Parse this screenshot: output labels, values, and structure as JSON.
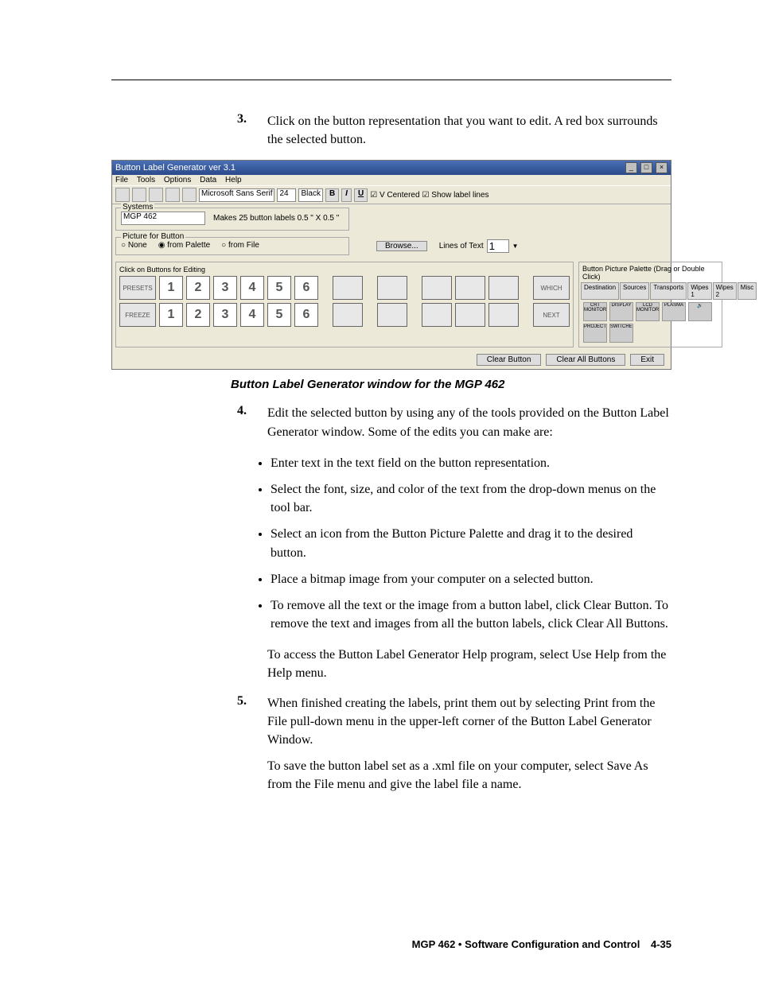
{
  "step3": {
    "num": "3.",
    "text": "Click on the button representation that you want to edit.  A red box surrounds the selected button."
  },
  "app": {
    "title": "Button Label Generator  ver 3.1",
    "minimize": "_",
    "restore": "□",
    "close": "×",
    "menu": {
      "file": "File",
      "tools": "Tools",
      "options": "Options",
      "data": "Data",
      "help": "Help"
    },
    "toolbar": {
      "font": "Microsoft Sans Serif",
      "size": "24",
      "color": "Black",
      "b": "B",
      "i": "I",
      "u": "U",
      "vc": "V Centered",
      "sl": "Show label lines"
    },
    "systems": {
      "label": "Systems",
      "value": "MGP 462",
      "note": "Makes 25 button labels 0.5 \" X 0.5 \""
    },
    "picture": {
      "label": "Picture for Button",
      "none": "None",
      "fromPal": "from Palette",
      "fromFile": "from File",
      "browse": "Browse...",
      "lot": "Lines of Text",
      "lotVal": "1"
    },
    "editHdr": "Click on Buttons for Editing",
    "row1": {
      "lbl": "PRESETS",
      "wide": "WHICH"
    },
    "row2": {
      "lbl": "FREEZE",
      "wide": "NEXT"
    },
    "palHdr": "Button Picture Palette (Drag or Double Click)",
    "tabs": {
      "dest": "Destination",
      "src": "Sources",
      "trans": "Transports",
      "w1": "Wipes 1",
      "w2": "Wipes 2",
      "misc": "Misc"
    },
    "icons": {
      "i1": "CRT MONITOR",
      "i2": "DISPLAY",
      "i3": "LCD MONITOR",
      "i4": "PLASMA",
      "i5": "🔊",
      "i6": "PROJECTOR",
      "i7": "SWITCHER"
    },
    "actions": {
      "clear": "Clear Button",
      "clearAll": "Clear All Buttons",
      "exit": "Exit"
    }
  },
  "caption": "Button Label Generator window for the MGP 462",
  "step4": {
    "num": "4.",
    "text": "Edit the selected button by using any of the tools provided on the Button Label Generator window.  Some of the edits you can make are:"
  },
  "bullets": {
    "b1": "Enter text in the text field on the button representation.",
    "b2": "Select the font, size, and color of the text from the drop-down menus on the tool bar.",
    "b3": "Select an icon from the Button Picture Palette and drag it to the desired button.",
    "b4": "Place a bitmap image from your computer on a selected button.",
    "b5": "To remove all the text or the image from a button label, click Clear Button.  To remove the text and images from all the button labels, click Clear All Buttons."
  },
  "help": "To access the Button Label Generator Help program, select Use Help from the Help menu.",
  "step5": {
    "num": "5.",
    "text": "When finished creating the labels, print them out by selecting Print from the File pull-down menu in the upper-left corner of the Button Label Generator Window."
  },
  "saveAs": "To save the button label set as a .xml file on your computer, select Save As from the File menu and give the label file a name.",
  "footer": {
    "sec": "MGP 462 • Software Configuration and Control",
    "page": "4-35"
  }
}
